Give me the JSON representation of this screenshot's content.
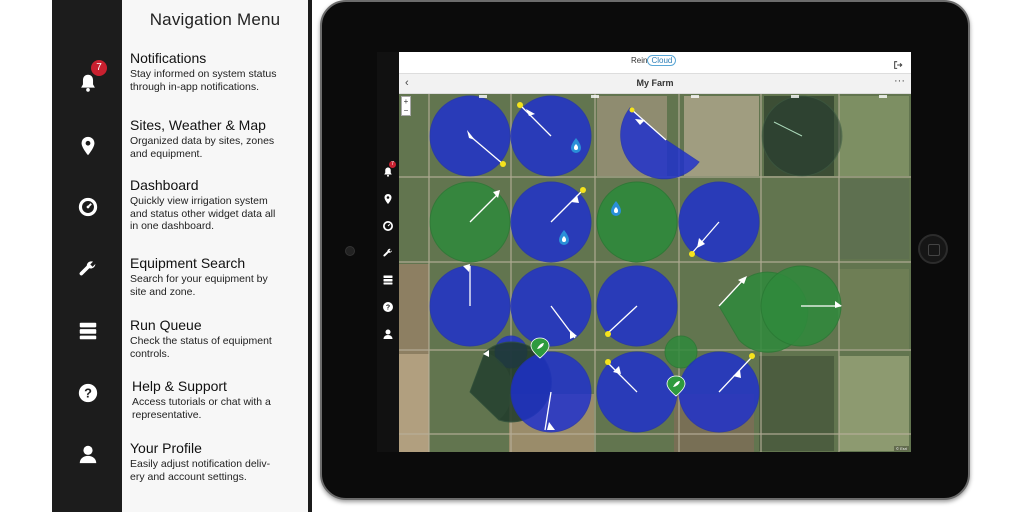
{
  "menu": {
    "title": "Navigation Menu",
    "notification_count": "7",
    "items": [
      {
        "icon": "bell-icon",
        "title": "Notifications",
        "desc": "Stay informed on system status\nthrough in-app notifications."
      },
      {
        "icon": "map-pin-icon",
        "title": "Sites, Weather & Map",
        "desc": "Organized data by sites, zones\nand equipment."
      },
      {
        "icon": "dashboard-gauge-icon",
        "title": "Dashboard",
        "desc": "Quickly view irrigation system\nand status other widget data all\nin one dashboard."
      },
      {
        "icon": "wrench-icon",
        "title": "Equipment Search",
        "desc": "Search for your equipment by\nsite and zone."
      },
      {
        "icon": "queue-stack-icon",
        "title": "Run Queue",
        "desc": "Check the status of equipment\ncontrols."
      },
      {
        "icon": "help-circle-icon",
        "title": "Help & Support",
        "desc": "Access tutorials or chat with a\nrepresentative."
      },
      {
        "icon": "user-icon",
        "title": "Your Profile",
        "desc": "Easily adjust notification deliv-\nery and account settings."
      }
    ]
  },
  "app": {
    "logo_left": "Rein",
    "logo_right": "Cloud",
    "back_glyph": "‹",
    "title": "My Farm",
    "more_glyph": "···",
    "zoom_in": "+",
    "zoom_out": "−",
    "attribution": "© Esri"
  },
  "colors": {
    "pivot_blue": "#1d2fd0",
    "pivot_green": "#2f8a3c",
    "pivot_dark": "#1f3a2a",
    "pivot_end_marker": "#f5e31c",
    "water_drop_marker": "#2a8fd8",
    "crop_marker": "#2e9a3e"
  }
}
